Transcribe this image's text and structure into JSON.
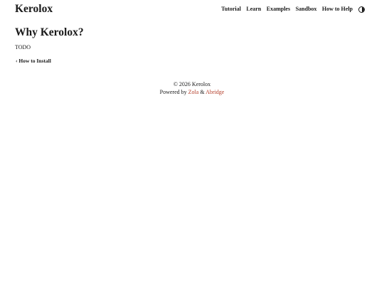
{
  "header": {
    "site_title": "Kerolox",
    "nav": [
      {
        "label": "Tutorial"
      },
      {
        "label": "Learn"
      },
      {
        "label": "Examples"
      },
      {
        "label": "Sandbox"
      },
      {
        "label": "How to Help"
      }
    ],
    "theme_toggle_icon": "half-circle-contrast-icon"
  },
  "main": {
    "title": "Why Kerolox?",
    "body": "TODO",
    "prev_link": "‹ How to Install"
  },
  "footer": {
    "copyright": "© 2026 Kerolox",
    "powered_by": "Powered by",
    "zola": "Zola",
    "amp": "&",
    "abridge": "Abridge",
    "link_color": "#b5412d"
  }
}
